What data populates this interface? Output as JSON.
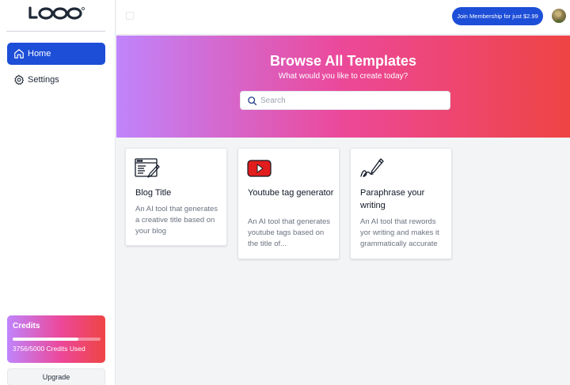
{
  "app": {
    "logo_text": "LOQO"
  },
  "sidebar": {
    "items": [
      {
        "label": "Home",
        "icon": "home-icon",
        "active": true
      },
      {
        "label": "Settings",
        "icon": "gear-icon",
        "active": false
      }
    ],
    "credits": {
      "title": "Credits",
      "used": 3756,
      "total": 5000,
      "text": "3756/5000 Credits Used",
      "progress_percent": 75
    },
    "upgrade_label": "Upgrade"
  },
  "header": {
    "membership_label": "Join Membership for just $2.99"
  },
  "hero": {
    "title": "Browse All Templates",
    "subtitle": "What would you like to create today?",
    "search_placeholder": "Search"
  },
  "templates": [
    {
      "title": "Blog Title",
      "description": "An AI tool that generates a creative title based on your blog",
      "icon": "blog-article-icon"
    },
    {
      "title": "Youtube tag generator",
      "description": "An AI tool that generates youtube tags based on the title of...",
      "icon": "youtube-icon"
    },
    {
      "title": "Paraphrase your writing",
      "description": "An AI tool that rewords yor writing and makes it grammatically accurate",
      "icon": "pen-signature-icon"
    }
  ],
  "colors": {
    "accent": "#1d4ed8",
    "gradient_start": "#c084fc",
    "gradient_mid": "#ec4899",
    "gradient_end": "#ef4444",
    "youtube_red": "#e11d1d"
  }
}
